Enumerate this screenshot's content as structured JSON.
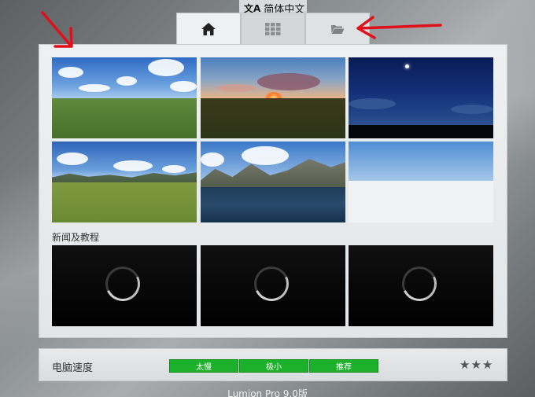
{
  "language": {
    "icon": "translate-icon",
    "label": "简体中文"
  },
  "tabs": [
    {
      "name": "home",
      "icon": "home-icon",
      "active": true
    },
    {
      "name": "grid",
      "icon": "grid-icon",
      "active": false
    },
    {
      "name": "open",
      "icon": "folder-icon",
      "active": false
    }
  ],
  "thumbnails": [
    {
      "scene": "grassland-cumulus"
    },
    {
      "scene": "sunset-field"
    },
    {
      "scene": "night-sky-moon"
    },
    {
      "scene": "grassland-mountains"
    },
    {
      "scene": "mountain-lake"
    },
    {
      "scene": "blank-sky"
    }
  ],
  "news": {
    "label": "新闻及教程",
    "items": [
      {
        "state": "loading"
      },
      {
        "state": "loading"
      },
      {
        "state": "loading"
      }
    ]
  },
  "speed": {
    "label": "电脑速度",
    "segments": [
      "太慢",
      "极小",
      "推荐"
    ],
    "stars": "★★★"
  },
  "footer": {
    "version": "Lumion Pro 9.0版"
  },
  "colors": {
    "arrow": "#e0101a",
    "speed_green": "#1bb12b"
  }
}
